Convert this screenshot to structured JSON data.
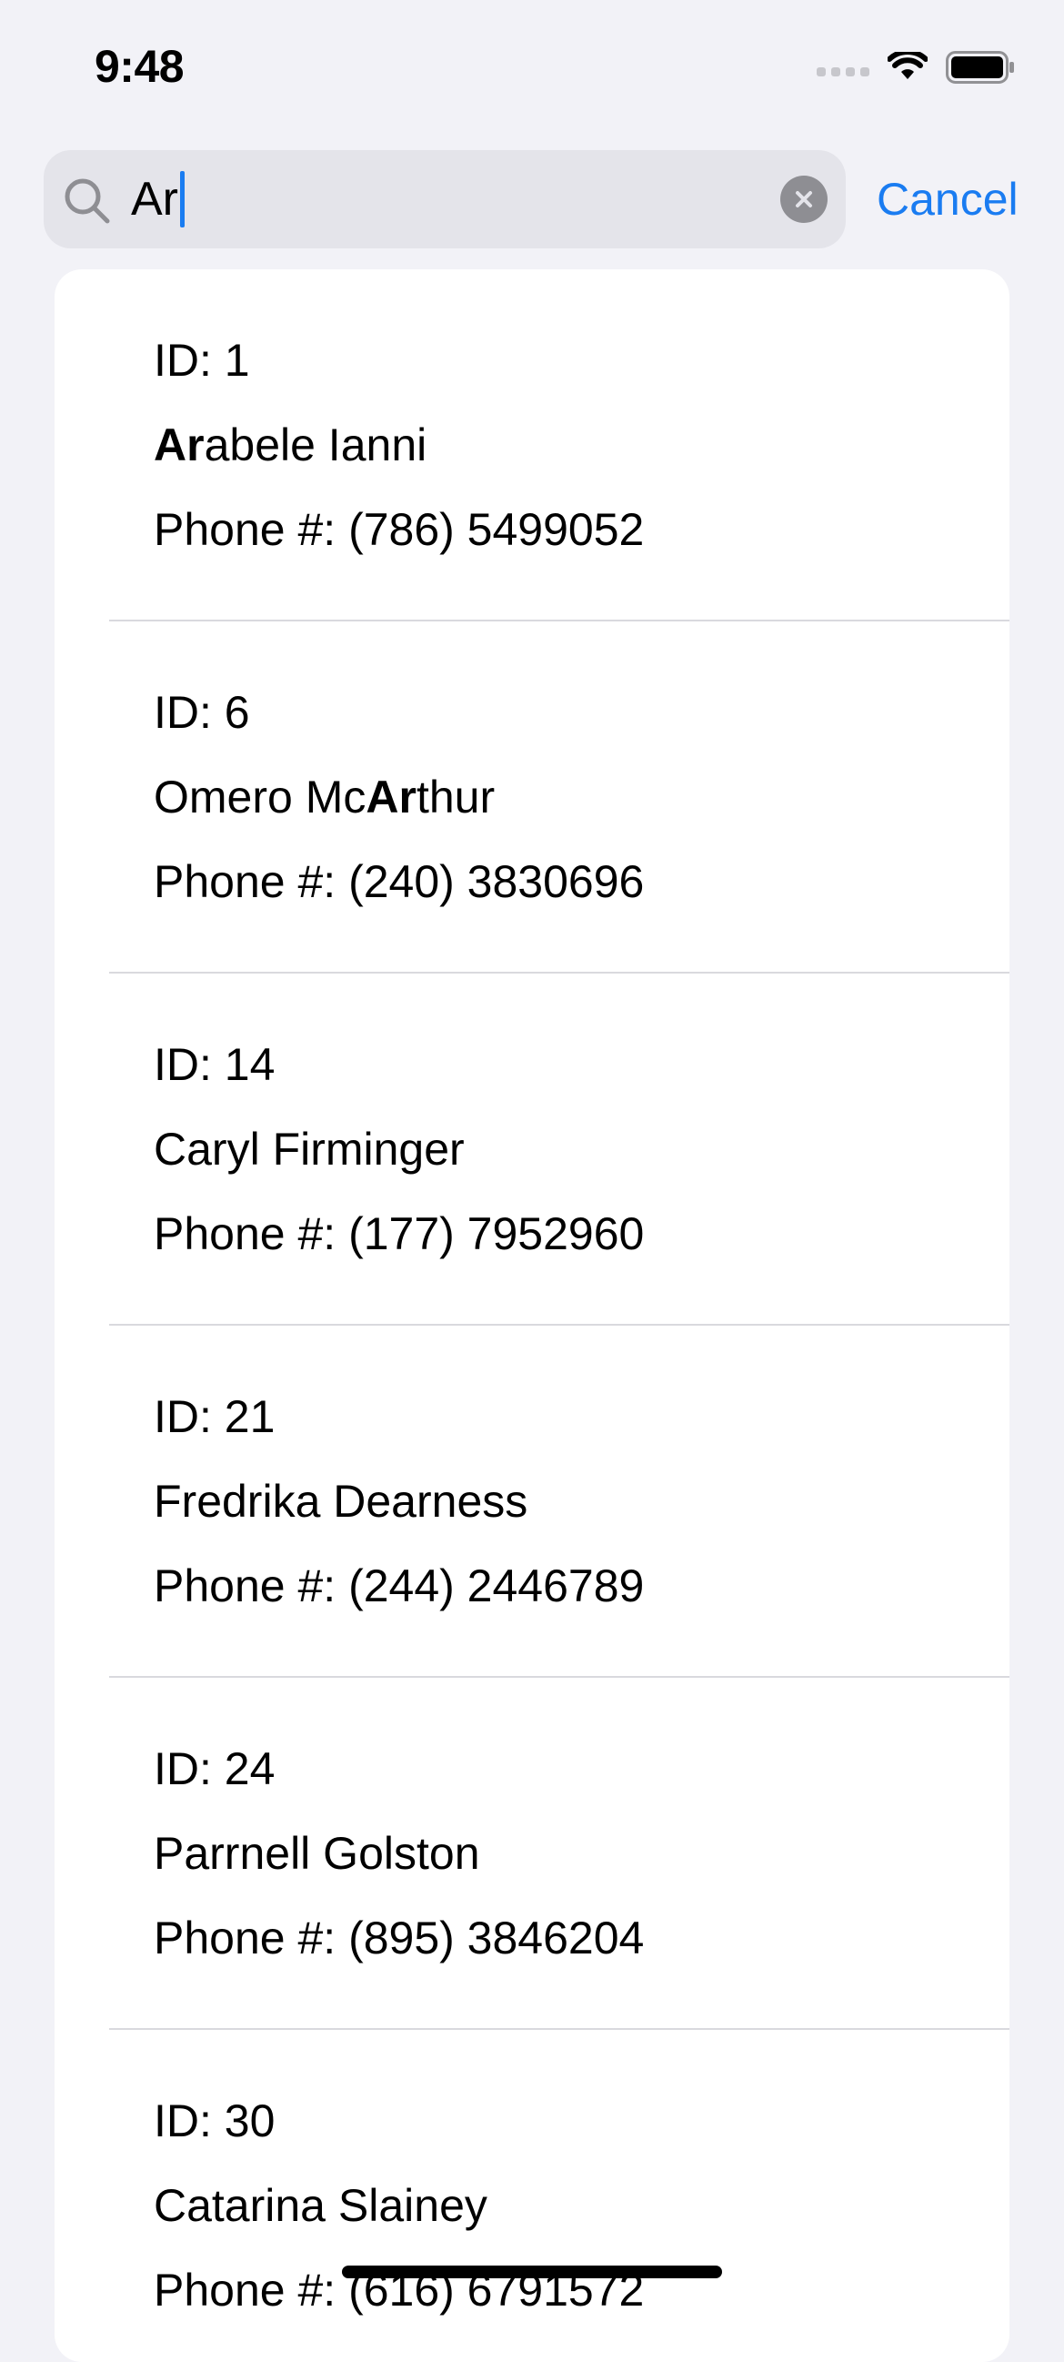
{
  "status_bar": {
    "time": "9:48",
    "icons": [
      "signal-icon",
      "wifi-icon",
      "battery-icon"
    ]
  },
  "search": {
    "query": "Ar",
    "cancel_label": "Cancel",
    "icons": [
      "search-icon",
      "clear-icon"
    ]
  },
  "results": [
    {
      "id": "ID: 1",
      "name_pre": "",
      "name_match": "Ar",
      "name_post": "abele Ianni",
      "phone": "Phone #: (786) 5499052"
    },
    {
      "id": "ID: 6",
      "name_pre": "Omero Mc",
      "name_match": "Ar",
      "name_post": "thur",
      "phone": "Phone #: (240) 3830696"
    },
    {
      "id": "ID: 14",
      "name_pre": "Caryl Firminger",
      "name_match": "",
      "name_post": "",
      "phone": "Phone #: (177) 7952960"
    },
    {
      "id": "ID: 21",
      "name_pre": "Fredrika Dearness",
      "name_match": "",
      "name_post": "",
      "phone": "Phone #: (244) 2446789"
    },
    {
      "id": "ID: 24",
      "name_pre": "Parrnell Golston",
      "name_match": "",
      "name_post": "",
      "phone": "Phone #: (895) 3846204"
    },
    {
      "id": "ID: 30",
      "name_pre": "Catarina Slainey",
      "name_match": "",
      "name_post": "",
      "phone": "Phone #: (616) 6791572"
    }
  ],
  "colors": {
    "accent": "#1A7CF1",
    "background": "#F2F2F7",
    "search_field": "#E4E4EA"
  }
}
